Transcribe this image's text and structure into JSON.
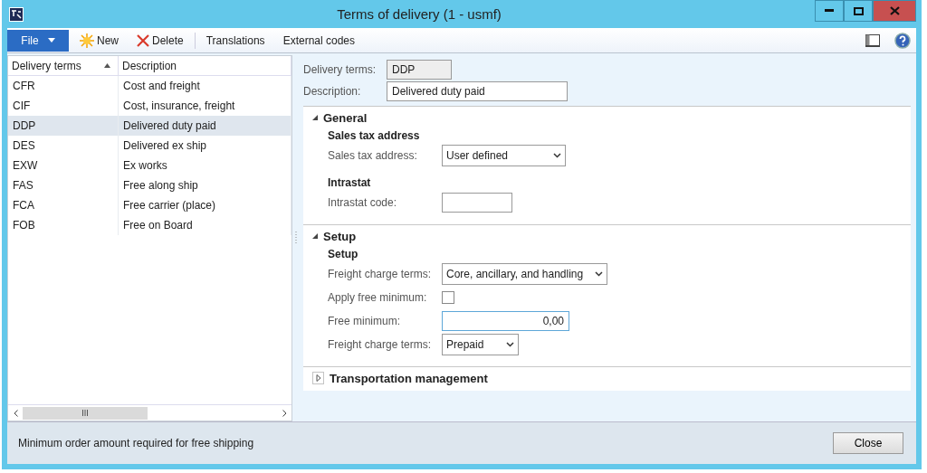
{
  "window": {
    "title": "Terms of delivery (1 - usmf)"
  },
  "toolbar": {
    "file": "File",
    "actions": [
      {
        "label": "New",
        "kind": "new"
      },
      {
        "label": "Delete",
        "kind": "delete"
      },
      {
        "label": "Translations",
        "kind": "plain"
      },
      {
        "label": "External codes",
        "kind": "plain"
      }
    ]
  },
  "list": {
    "columns": [
      {
        "label": "Delivery terms",
        "sorted": true
      },
      {
        "label": "Description",
        "sorted": false
      }
    ],
    "rows": [
      {
        "code": "CFR",
        "description": "Cost and freight",
        "selected": false
      },
      {
        "code": "CIF",
        "description": "Cost, insurance, freight",
        "selected": false
      },
      {
        "code": "DDP",
        "description": "Delivered duty paid",
        "selected": true
      },
      {
        "code": "DES",
        "description": "Delivered ex ship",
        "selected": false
      },
      {
        "code": "EXW",
        "description": "Ex works",
        "selected": false
      },
      {
        "code": "FAS",
        "description": "Free along ship",
        "selected": false
      },
      {
        "code": "FCA",
        "description": "Free carrier (place)",
        "selected": false
      },
      {
        "code": "FOB",
        "description": "Free on Board",
        "selected": false
      }
    ]
  },
  "header_fields": [
    {
      "label": "Delivery terms:",
      "value": "DDP",
      "kind": "readonly"
    },
    {
      "label": "Description:",
      "value": "Delivered duty paid",
      "kind": "text"
    }
  ],
  "sections": [
    {
      "title": "General",
      "expanded": true,
      "groups": [
        {
          "title": "Sales tax address",
          "fields": [
            {
              "label": "Sales tax address:",
              "value": "User defined",
              "kind": "select"
            }
          ]
        },
        {
          "title": "Intrastat",
          "fields": [
            {
              "label": "Intrastat code:",
              "kind": "text"
            }
          ]
        }
      ]
    },
    {
      "title": "Setup",
      "expanded": true,
      "groups": [
        {
          "title": "Setup",
          "fields": [
            {
              "label": "Freight charge terms:",
              "value": "Core, ancillary, and handling",
              "kind": "select"
            },
            {
              "label": "Apply free minimum:",
              "kind": "checkbox",
              "checked": false
            },
            {
              "label": "Free minimum:",
              "value": "0,00",
              "kind": "number"
            },
            {
              "label": "Freight charge terms:",
              "value": "Prepaid",
              "kind": "select"
            }
          ]
        }
      ]
    },
    {
      "title": "Transportation management",
      "expanded": false
    }
  ],
  "status_bar": {
    "text": "Minimum order amount required for free shipping",
    "button": "Close"
  }
}
